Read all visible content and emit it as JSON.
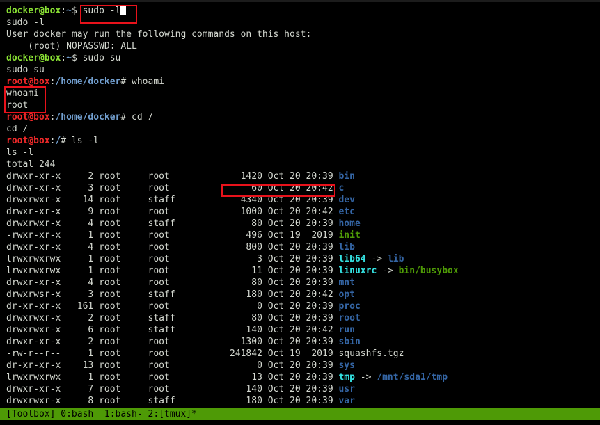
{
  "colors": {
    "background": "#000000",
    "text": "#d3d7cf",
    "prompt_user": "#8ae234",
    "prompt_root": "#ef2929",
    "prompt_path": "#729fcf",
    "dir": "#3465a4",
    "exec": "#4e9a06",
    "symlink": "#34e2e2",
    "highlight_box": "#e8121b",
    "status_bar": "#4e9a06"
  },
  "session": [
    {
      "user": "docker@box",
      "sep": ":",
      "path": "~",
      "sym": "$ ",
      "cmd": "sudo -l"
    },
    {
      "text": "sudo -l"
    },
    {
      "text": "User docker may run the following commands on this host:"
    },
    {
      "text": "    (root) NOPASSWD: ALL"
    },
    {
      "user": "docker@box",
      "sep": ":",
      "path": "~",
      "sym": "$ ",
      "cmd": "sudo su"
    },
    {
      "text": "sudo su"
    },
    {
      "user": "root@box",
      "sep": ":",
      "path": "/home/docker",
      "sym": "# ",
      "cmd": "whoami"
    },
    {
      "text": "whoami"
    },
    {
      "text": "root"
    },
    {
      "user": "root@box",
      "sep": ":",
      "path": "/home/docker",
      "sym": "# ",
      "cmd": "cd /"
    },
    {
      "text": "cd /"
    },
    {
      "user": "root@box",
      "sep": ":",
      "path": "/",
      "sym": "# ",
      "cmd": "ls -l"
    },
    {
      "text": "ls -l"
    },
    {
      "text": "total 244"
    }
  ],
  "listing": [
    {
      "perm": "drwxr-xr-x",
      "links": "2",
      "owner": "root",
      "group": "root",
      "size": "1420",
      "date": "Oct 20 20:39",
      "name": "bin",
      "kind": "dir"
    },
    {
      "perm": "drwxr-xr-x",
      "links": "3",
      "owner": "root",
      "group": "root",
      "size": "60",
      "date": "Oct 20 20:42",
      "name": "c",
      "kind": "dir"
    },
    {
      "perm": "drwxrwxr-x",
      "links": "14",
      "owner": "root",
      "group": "staff",
      "size": "4340",
      "date": "Oct 20 20:39",
      "name": "dev",
      "kind": "dir"
    },
    {
      "perm": "drwxr-xr-x",
      "links": "9",
      "owner": "root",
      "group": "root",
      "size": "1000",
      "date": "Oct 20 20:42",
      "name": "etc",
      "kind": "dir"
    },
    {
      "perm": "drwxrwxr-x",
      "links": "4",
      "owner": "root",
      "group": "staff",
      "size": "80",
      "date": "Oct 20 20:39",
      "name": "home",
      "kind": "dir"
    },
    {
      "perm": "-rwxr-xr-x",
      "links": "1",
      "owner": "root",
      "group": "root",
      "size": "496",
      "date": "Oct 19  2019",
      "name": "init",
      "kind": "exec"
    },
    {
      "perm": "drwxr-xr-x",
      "links": "4",
      "owner": "root",
      "group": "root",
      "size": "800",
      "date": "Oct 20 20:39",
      "name": "lib",
      "kind": "dir"
    },
    {
      "perm": "lrwxrwxrwx",
      "links": "1",
      "owner": "root",
      "group": "root",
      "size": "3",
      "date": "Oct 20 20:39",
      "name": "lib64",
      "kind": "link",
      "arrow": " -> ",
      "target": "lib",
      "target_kind": "dir"
    },
    {
      "perm": "lrwxrwxrwx",
      "links": "1",
      "owner": "root",
      "group": "root",
      "size": "11",
      "date": "Oct 20 20:39",
      "name": "linuxrc",
      "kind": "link",
      "arrow": " -> ",
      "target": "bin/busybox",
      "target_kind": "exec"
    },
    {
      "perm": "drwxr-xr-x",
      "links": "4",
      "owner": "root",
      "group": "root",
      "size": "80",
      "date": "Oct 20 20:39",
      "name": "mnt",
      "kind": "dir"
    },
    {
      "perm": "drwxrwsr-x",
      "links": "3",
      "owner": "root",
      "group": "staff",
      "size": "180",
      "date": "Oct 20 20:42",
      "name": "opt",
      "kind": "dir"
    },
    {
      "perm": "dr-xr-xr-x",
      "links": "161",
      "owner": "root",
      "group": "root",
      "size": "0",
      "date": "Oct 20 20:39",
      "name": "proc",
      "kind": "dir"
    },
    {
      "perm": "drwxrwxr-x",
      "links": "2",
      "owner": "root",
      "group": "staff",
      "size": "80",
      "date": "Oct 20 20:39",
      "name": "root",
      "kind": "dir"
    },
    {
      "perm": "drwxrwxr-x",
      "links": "6",
      "owner": "root",
      "group": "staff",
      "size": "140",
      "date": "Oct 20 20:42",
      "name": "run",
      "kind": "dir"
    },
    {
      "perm": "drwxr-xr-x",
      "links": "2",
      "owner": "root",
      "group": "root",
      "size": "1300",
      "date": "Oct 20 20:39",
      "name": "sbin",
      "kind": "dir"
    },
    {
      "perm": "-rw-r--r--",
      "links": "1",
      "owner": "root",
      "group": "root",
      "size": "241842",
      "date": "Oct 19  2019",
      "name": "squashfs.tgz",
      "kind": "file"
    },
    {
      "perm": "dr-xr-xr-x",
      "links": "13",
      "owner": "root",
      "group": "root",
      "size": "0",
      "date": "Oct 20 20:39",
      "name": "sys",
      "kind": "dir"
    },
    {
      "perm": "lrwxrwxrwx",
      "links": "1",
      "owner": "root",
      "group": "root",
      "size": "13",
      "date": "Oct 20 20:39",
      "name": "tmp",
      "kind": "link",
      "arrow": " -> ",
      "target": "/mnt/sda1/tmp",
      "target_kind": "dir"
    },
    {
      "perm": "drwxr-xr-x",
      "links": "7",
      "owner": "root",
      "group": "root",
      "size": "140",
      "date": "Oct 20 20:39",
      "name": "usr",
      "kind": "dir"
    },
    {
      "perm": "drwxrwxr-x",
      "links": "8",
      "owner": "root",
      "group": "staff",
      "size": "180",
      "date": "Oct 20 20:39",
      "name": "var",
      "kind": "dir"
    }
  ],
  "status_bar": {
    "text": "[Toolbox] 0:bash  1:bash- 2:[tmux]*"
  }
}
